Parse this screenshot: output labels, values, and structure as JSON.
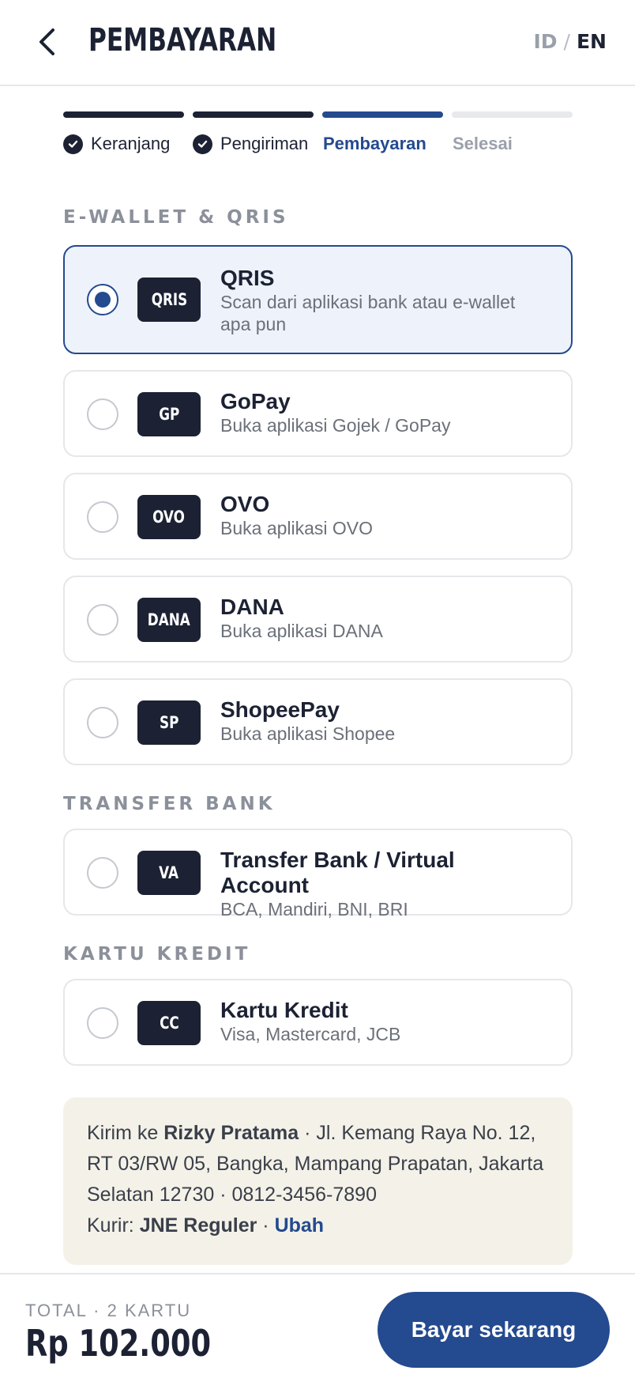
{
  "header": {
    "title": "PEMBAYARAN",
    "lang_id": "ID",
    "lang_sep": "/",
    "lang_en": "EN",
    "back_icon": "chevron-left-icon"
  },
  "stepper": {
    "steps": [
      {
        "label": "Keranjang",
        "state": "done"
      },
      {
        "label": "Pengiriman",
        "state": "done"
      },
      {
        "label": "Pembayaran",
        "state": "active"
      },
      {
        "label": "Selesai",
        "state": "todo"
      }
    ]
  },
  "sections": {
    "ewallet": "E-WALLET & QRIS",
    "bank": "TRANSFER BANK",
    "card": "KARTU KREDIT"
  },
  "options": [
    {
      "code": "QRIS",
      "name": "QRIS",
      "desc": "Scan dari aplikasi bank atau e-wallet apa pun",
      "selected": true
    },
    {
      "code": "GP",
      "name": "GoPay",
      "desc": "Buka aplikasi Gojek / GoPay",
      "selected": false
    },
    {
      "code": "OVO",
      "name": "OVO",
      "desc": "Buka aplikasi OVO",
      "selected": false
    },
    {
      "code": "DANA",
      "name": "DANA",
      "desc": "Buka aplikasi DANA",
      "selected": false
    },
    {
      "code": "SP",
      "name": "ShopeePay",
      "desc": "Buka aplikasi Shopee",
      "selected": false
    },
    {
      "code": "VA",
      "name": "Transfer Bank / Virtual Account",
      "desc": "BCA, Mandiri, BNI, BRI",
      "selected": false
    },
    {
      "code": "CC",
      "name": "Kartu Kredit",
      "desc": "Visa, Mastercard, JCB",
      "selected": false
    }
  ],
  "shipping": {
    "prefix": "Kirim ke ",
    "recipient": "Rizky Pratama",
    "address": " · Jl. Kemang Raya No. 12, RT 03/RW 05, Bangka, Mampang Prapatan, Jakarta Selatan 12730 · 0812-3456-7890",
    "courier_prefix": "Kurir: ",
    "courier": "JNE Reguler",
    "sep": " · ",
    "change": "Ubah"
  },
  "footer": {
    "total_label": "TOTAL · 2 KARTU",
    "total_value": "Rp 102.000",
    "pay_label": "Bayar sekarang"
  },
  "colors": {
    "primary": "#244a8f",
    "dark": "#1c2233",
    "muted": "#8b909a",
    "selected_bg": "#eef2fb",
    "info_bg": "#f4f2e8"
  }
}
